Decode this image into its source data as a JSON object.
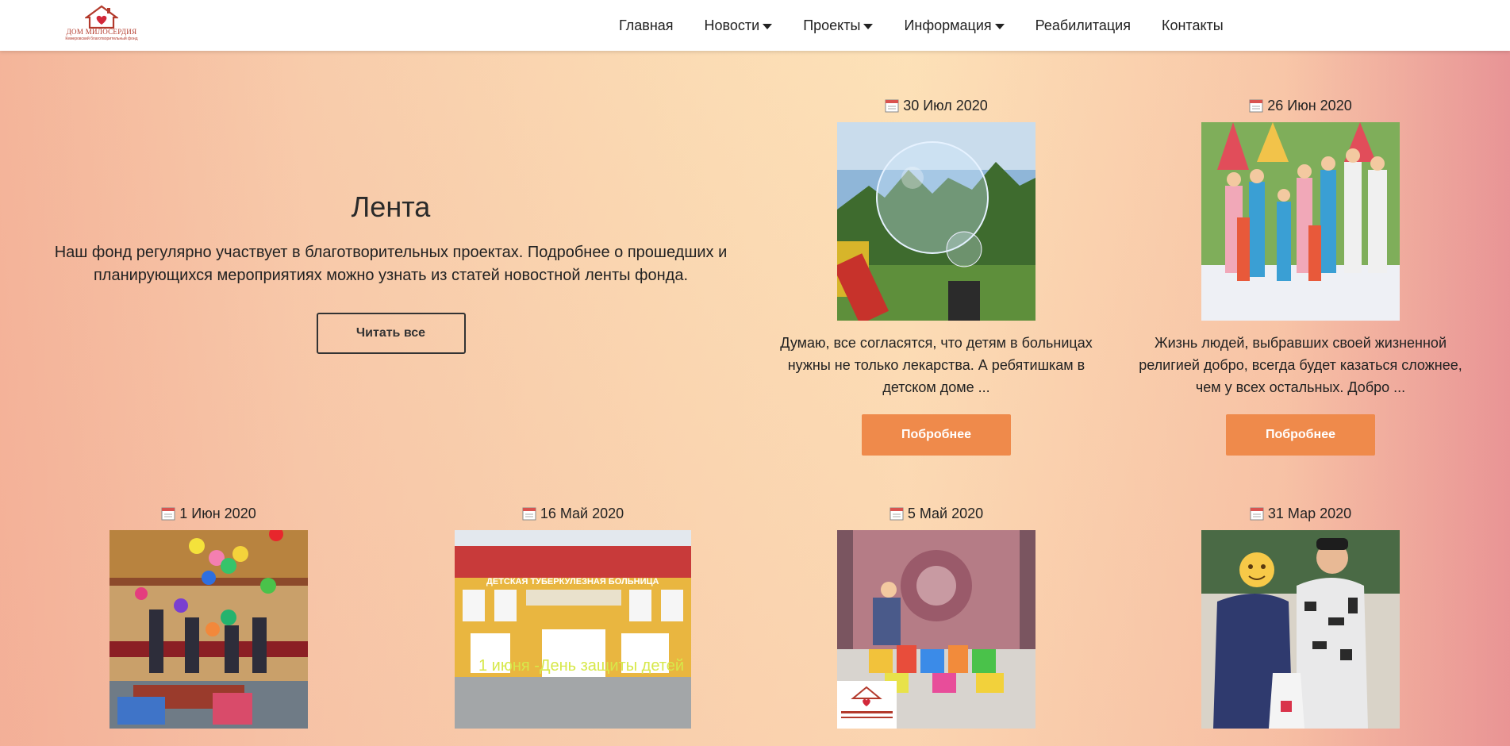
{
  "brand": {
    "name": "ДОМ МИЛОСЕРДИЯ",
    "tagline": "Кемеровский благотворительный фонд",
    "accent": "#ef8a4b",
    "logo_red": "#c0392b"
  },
  "nav": {
    "items": [
      {
        "label": "Главная",
        "dropdown": false
      },
      {
        "label": "Новости",
        "dropdown": true
      },
      {
        "label": "Проекты",
        "dropdown": true
      },
      {
        "label": "Информация",
        "dropdown": true
      },
      {
        "label": "Реабилитация",
        "dropdown": false
      },
      {
        "label": "Контакты",
        "dropdown": false
      }
    ]
  },
  "hero": {
    "title": "Лента",
    "text": "Наш фонд регулярно участвует в благотворительных проектах. Подробнее о прошедших и планирующихся мероприятиях можно узнать из статей новостной ленты фонда.",
    "button": "Читать все"
  },
  "posts": [
    {
      "date": "30 Июл 2020",
      "excerpt": "Думаю, все согласятся, что детям в больницах нужны не только лекарства. А ребятишкам в детском доме ...",
      "button": "Побробнее",
      "image": "soap-bubbles-playground"
    },
    {
      "date": "26 Июн 2020",
      "excerpt": "Жизнь людей, выбравших своей жизненной религией добро, всегда будет казаться сложнее, чем у всех остальных. Добро ...",
      "button": "Побробнее",
      "image": "children-group-photo"
    },
    {
      "date": "1 Июн 2020",
      "image": "balloons-children"
    },
    {
      "date": "16 Май 2020",
      "image": "hospital-building",
      "overlay_text": "1 июня -День защиты детей",
      "building_sign": "ДЕТСКАЯ ТУБЕРКУЛЕЗНАЯ БОЛЬНИЦА"
    },
    {
      "date": "5 Май 2020",
      "image": "donations-table"
    },
    {
      "date": "31 Мар 2020",
      "image": "two-people-with-bag"
    }
  ]
}
